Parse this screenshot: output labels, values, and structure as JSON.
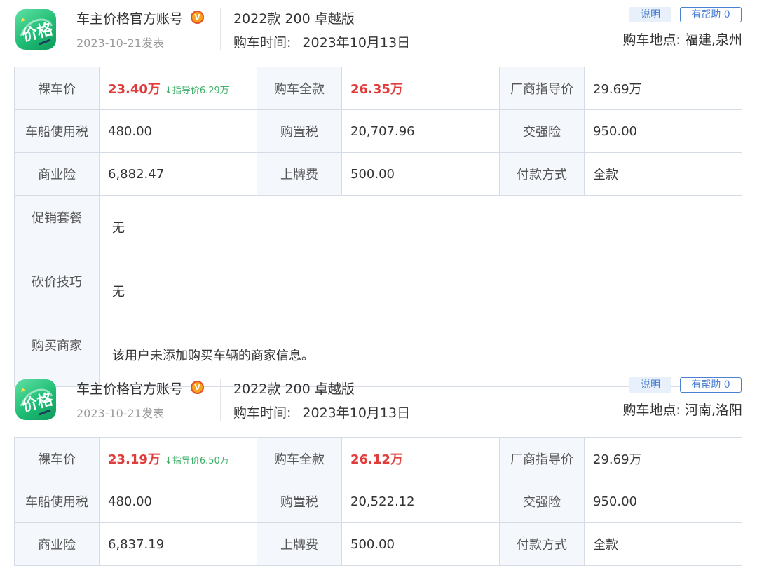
{
  "posts": [
    {
      "author": "车主价格官方账号",
      "verified_badge": "V",
      "post_time": "2023-10-21发表",
      "model": "2022款 200 卓越版",
      "purchase_date_label": "购车时间:",
      "purchase_date": "2023年10月13日",
      "explain_btn": "说明",
      "helpful_btn": "有帮助 0",
      "location": "购车地点: 福建,泉州",
      "table": {
        "bare_price_label": "裸车价",
        "bare_price": "23.40万",
        "guide_diff": "↓指导价6.29万",
        "total_label": "购车全款",
        "total": "26.35万",
        "msrp_label": "厂商指导价",
        "msrp": "29.69万",
        "vessel_tax_label": "车船使用税",
        "vessel_tax": "480.00",
        "purchase_tax_label": "购置税",
        "purchase_tax": "20,707.96",
        "compulsory_ins_label": "交强险",
        "compulsory_ins": "950.00",
        "commercial_ins_label": "商业险",
        "commercial_ins": "6,882.47",
        "plate_fee_label": "上牌费",
        "plate_fee": "500.00",
        "payment_label": "付款方式",
        "payment": "全款",
        "promo_label": "促销套餐",
        "promo": "无",
        "bargain_label": "砍价技巧",
        "bargain": "无",
        "dealer_label": "购买商家",
        "dealer": "该用户未添加购买车辆的商家信息。"
      }
    },
    {
      "author": "车主价格官方账号",
      "verified_badge": "V",
      "post_time": "2023-10-21发表",
      "model": "2022款 200 卓越版",
      "purchase_date_label": "购车时间:",
      "purchase_date": "2023年10月13日",
      "explain_btn": "说明",
      "helpful_btn": "有帮助 0",
      "location": "购车地点: 河南,洛阳",
      "table": {
        "bare_price_label": "裸车价",
        "bare_price": "23.19万",
        "guide_diff": "↓指导价6.50万",
        "total_label": "购车全款",
        "total": "26.12万",
        "msrp_label": "厂商指导价",
        "msrp": "29.69万",
        "vessel_tax_label": "车船使用税",
        "vessel_tax": "480.00",
        "purchase_tax_label": "购置税",
        "purchase_tax": "20,522.12",
        "compulsory_ins_label": "交强险",
        "compulsory_ins": "950.00",
        "commercial_ins_label": "商业险",
        "commercial_ins": "6,837.19",
        "plate_fee_label": "上牌费",
        "plate_fee": "500.00",
        "payment_label": "付款方式",
        "payment": "全款"
      }
    }
  ],
  "colors": {
    "accent_blue": "#4a7fd1",
    "price_red": "#e13c3c",
    "diff_green": "#3fb06a",
    "badge_orange": "#f7a31b"
  },
  "icons": {
    "avatar": "price-logo-icon",
    "verified": "verified-v-icon"
  }
}
